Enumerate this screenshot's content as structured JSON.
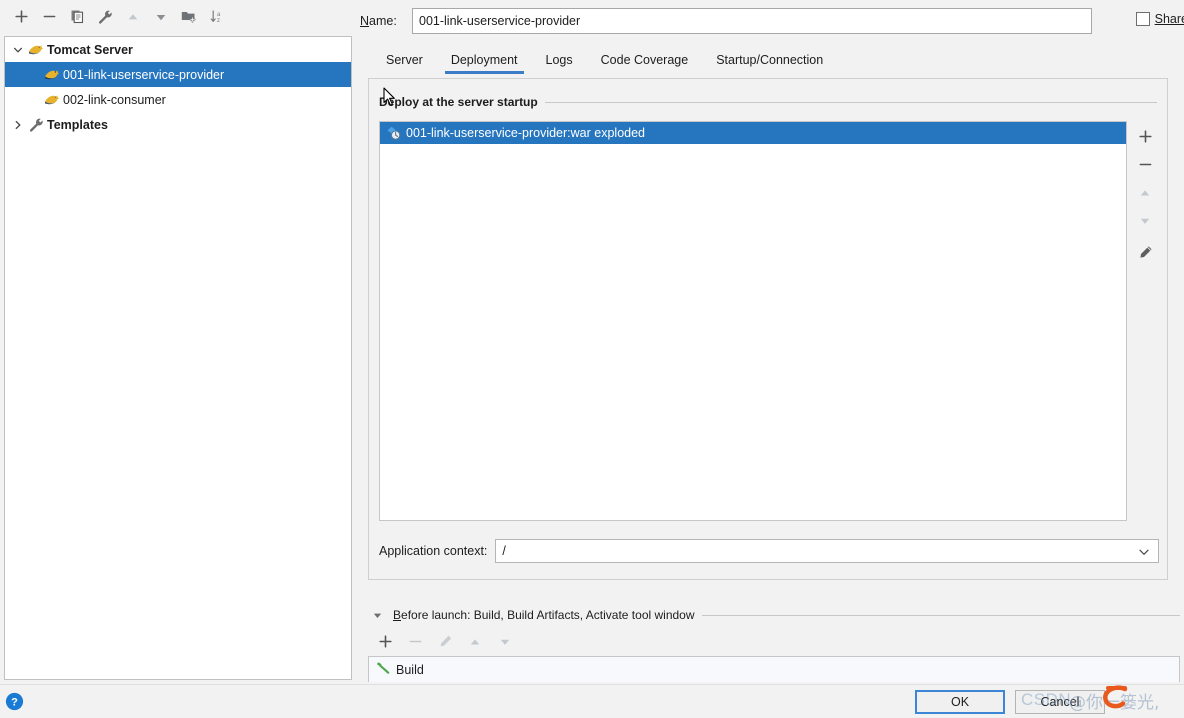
{
  "left_toolbar": {
    "buttons": [
      {
        "name": "add-configuration-button",
        "icon": "plus-icon",
        "label": "+",
        "enabled": true
      },
      {
        "name": "remove-configuration-button",
        "icon": "minus-icon",
        "label": "−",
        "enabled": true
      },
      {
        "name": "copy-configuration-button",
        "icon": "copy-icon",
        "label": "Copy Configuration",
        "enabled": true
      },
      {
        "name": "edit-templates-button",
        "icon": "wrench-icon",
        "label": "Edit Templates",
        "enabled": true
      },
      {
        "name": "move-up-button",
        "icon": "arrow-up-icon",
        "label": "Move Up",
        "enabled": false
      },
      {
        "name": "move-down-button",
        "icon": "arrow-down-icon",
        "label": "Move Down",
        "enabled": true
      },
      {
        "name": "create-folder-button",
        "icon": "folder-add-icon",
        "label": "Create New Folder",
        "enabled": true
      },
      {
        "name": "sort-configurations-button",
        "icon": "sort-az-icon",
        "label": "Sort Configurations",
        "enabled": true
      }
    ]
  },
  "tree": {
    "nodes": [
      {
        "label": "Tomcat Server",
        "icon": "tomcat-icon",
        "level": 0,
        "expanded": true,
        "bold": true,
        "selected": false,
        "has_twisty": true
      },
      {
        "label": "001-link-userservice-provider",
        "icon": "tomcat-icon",
        "level": 1,
        "bold": false,
        "selected": true,
        "has_twisty": false
      },
      {
        "label": "002-link-consumer",
        "icon": "tomcat-icon",
        "level": 1,
        "bold": false,
        "selected": false,
        "has_twisty": false
      },
      {
        "label": "Templates",
        "icon": "wrench-icon",
        "level": 0,
        "expanded": false,
        "bold": true,
        "selected": false,
        "has_twisty": true
      }
    ]
  },
  "name_row": {
    "label": "Name:",
    "label_mnemonic": "N",
    "value": "001-link-userservice-provider",
    "placeholder": ""
  },
  "share": {
    "label": "Share",
    "checked": false
  },
  "tabs": [
    {
      "label": "Server",
      "active": false
    },
    {
      "label": "Deployment",
      "active": true
    },
    {
      "label": "Logs",
      "active": false
    },
    {
      "label": "Code Coverage",
      "active": false
    },
    {
      "label": "Startup/Connection",
      "active": false
    }
  ],
  "deployment": {
    "legend": "Deploy at the server startup",
    "items": [
      {
        "label": "001-link-userservice-provider:war exploded",
        "icon": "artifact-icon",
        "selected": true
      }
    ],
    "side_buttons": [
      {
        "name": "add-artifact-button",
        "icon": "plus-icon",
        "label": "Add",
        "enabled": true
      },
      {
        "name": "remove-artifact-button",
        "icon": "minus-icon",
        "label": "Remove",
        "enabled": true
      },
      {
        "name": "artifact-move-up-button",
        "icon": "arrow-up-icon",
        "label": "Move Up",
        "enabled": false
      },
      {
        "name": "artifact-move-down-button",
        "icon": "arrow-down-icon",
        "label": "Move Down",
        "enabled": false
      },
      {
        "name": "edit-artifact-button",
        "icon": "pencil-icon",
        "label": "Edit",
        "enabled": true
      }
    ],
    "application_context": {
      "label": "Application context:",
      "value": "/",
      "options": [
        "/"
      ]
    }
  },
  "before_launch": {
    "title": "Before launch: Build, Build Artifacts, Activate tool window",
    "title_mnemonic": "B",
    "expanded": true,
    "toolbar": [
      {
        "name": "before-launch-add-button",
        "icon": "plus-icon",
        "label": "Add",
        "enabled": true
      },
      {
        "name": "before-launch-remove-button",
        "icon": "minus-icon",
        "label": "Remove",
        "enabled": false
      },
      {
        "name": "before-launch-edit-button",
        "icon": "pencil-icon",
        "label": "Edit",
        "enabled": false
      },
      {
        "name": "before-launch-move-up-button",
        "icon": "arrow-up-icon",
        "label": "Move Up",
        "enabled": false
      },
      {
        "name": "before-launch-move-down-button",
        "icon": "arrow-down-icon",
        "label": "Move Down",
        "enabled": false
      }
    ],
    "items": [
      {
        "label": "Build",
        "icon": "hammer-icon"
      }
    ]
  },
  "bottom_bar": {
    "help_icon": "help-circle-icon",
    "ok_label": "OK",
    "cancel_label": "Cancel"
  },
  "watermark": {
    "brand": "CSDN",
    "text": "@你一篓光,"
  },
  "colors": {
    "selection_blue": "#2675bf",
    "tab_underline": "#3d7dc7",
    "ok_border": "#3d86d6",
    "panel_bg": "#f2f2f2",
    "field_bg": "#ffffff",
    "tomcat_yellow": "#e8b32c",
    "hammer_green": "#51a74f",
    "help_blue": "#1a7bd4"
  }
}
